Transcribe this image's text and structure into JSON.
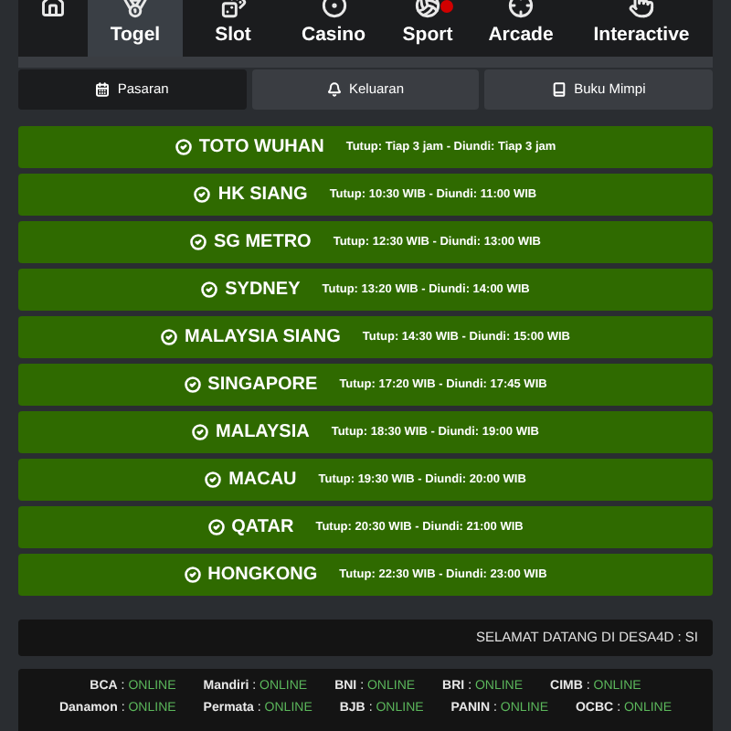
{
  "nav": [
    {
      "kind": "home",
      "selected": false
    },
    {
      "kind": "togel",
      "label": "Togel",
      "selected": true
    },
    {
      "kind": "slot",
      "label": "Slot",
      "selected": false
    },
    {
      "kind": "casino",
      "label": "Casino",
      "selected": false
    },
    {
      "kind": "sport",
      "label": "Sport",
      "selected": false,
      "badge": true
    },
    {
      "kind": "arcade",
      "label": "Arcade",
      "selected": false
    },
    {
      "kind": "interactive",
      "label": "Interactive",
      "selected": false
    }
  ],
  "subtabs": [
    {
      "kind": "calendar",
      "label": "Pasaran",
      "selected": true
    },
    {
      "kind": "bell",
      "label": "Keluaran",
      "selected": false
    },
    {
      "kind": "book",
      "label": "Buku Mimpi",
      "selected": false
    }
  ],
  "markets": [
    {
      "name": "TOTO WUHAN",
      "schedule": "Tutup: Tiap 3 jam - Diundi: Tiap 3 jam"
    },
    {
      "name": "HK SIANG",
      "schedule": "Tutup: 10:30 WIB - Diundi: 11:00 WIB"
    },
    {
      "name": "SG METRO",
      "schedule": "Tutup: 12:30 WIB - Diundi: 13:00 WIB"
    },
    {
      "name": "SYDNEY",
      "schedule": "Tutup: 13:20 WIB - Diundi: 14:00 WIB"
    },
    {
      "name": "MALAYSIA SIANG",
      "schedule": "Tutup: 14:30 WIB - Diundi: 15:00 WIB"
    },
    {
      "name": "SINGAPORE",
      "schedule": "Tutup: 17:20 WIB - Diundi: 17:45 WIB"
    },
    {
      "name": "MALAYSIA",
      "schedule": "Tutup: 18:30 WIB - Diundi: 19:00 WIB"
    },
    {
      "name": "MACAU",
      "schedule": "Tutup: 19:30 WIB - Diundi: 20:00 WIB"
    },
    {
      "name": "QATAR",
      "schedule": "Tutup: 20:30 WIB - Diundi: 21:00 WIB"
    },
    {
      "name": "HONGKONG",
      "schedule": "Tutup: 22:30 WIB - Diundi: 23:00 WIB"
    }
  ],
  "marquee": "SELAMAT DATANG DI DESA4D : SI",
  "banks": [
    [
      {
        "name": "BCA",
        "sep": ":",
        "status": "ONLINE"
      },
      {
        "name": "Mandiri",
        "sep": ":",
        "status": "ONLINE"
      },
      {
        "name": "BNI",
        "sep": ":",
        "status": "ONLINE"
      },
      {
        "name": "BRI",
        "sep": ":",
        "status": "ONLINE"
      },
      {
        "name": "CIMB",
        "sep": ":",
        "status": "ONLINE"
      }
    ],
    [
      {
        "name": "Danamon",
        "sep": ":",
        "status": "ONLINE"
      },
      {
        "name": "Permata",
        "sep": ":",
        "status": "ONLINE"
      },
      {
        "name": "BJB",
        "sep": ":",
        "status": "ONLINE"
      },
      {
        "name": "PANIN",
        "sep": ":",
        "status": "ONLINE"
      },
      {
        "name": "OCBC",
        "sep": ":",
        "status": "ONLINE"
      }
    ]
  ]
}
